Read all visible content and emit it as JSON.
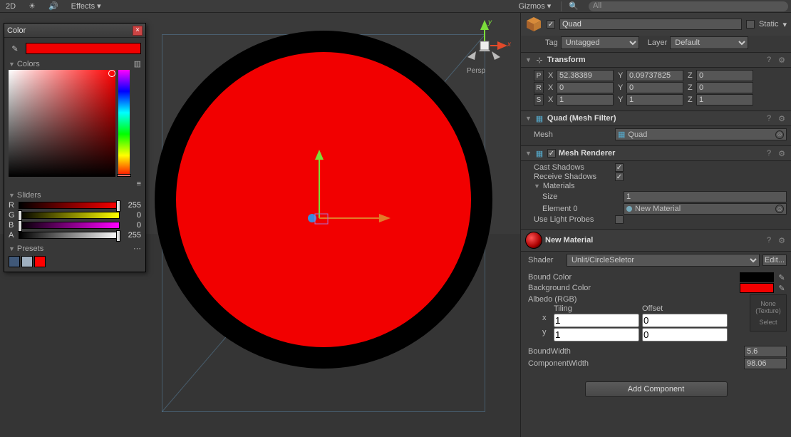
{
  "toolbar": {
    "btn_2d": "2D",
    "effects": "Effects",
    "gizmos": "Gizmos",
    "search_placeholder": "All"
  },
  "scene": {
    "persp_label": "Persp",
    "axis_x": "x",
    "axis_y": "y"
  },
  "color_picker": {
    "title": "Color",
    "colors_hdr": "Colors",
    "sliders_hdr": "Sliders",
    "presets_hdr": "Presets",
    "r_label": "R",
    "r_val": "255",
    "g_label": "G",
    "g_val": "0",
    "b_label": "B",
    "b_val": "0",
    "a_label": "A",
    "a_val": "255",
    "current_hex": "#FF0000",
    "presets": [
      "#405878",
      "#a0b0c0",
      "#ff0000"
    ]
  },
  "inspector": {
    "obj_name": "Quad",
    "static_label": "Static",
    "tag_label": "Tag",
    "tag_value": "Untagged",
    "layer_label": "Layer",
    "layer_value": "Default",
    "transform": {
      "name": "Transform",
      "p_label": "P",
      "r_label": "R",
      "s_label": "S",
      "px": "52.38389",
      "py": "0.09737825",
      "pz": "0",
      "rx": "0",
      "ry": "0",
      "rz": "0",
      "sx": "1",
      "sy": "1",
      "sz": "1",
      "X": "X",
      "Y": "Y",
      "Z": "Z"
    },
    "mesh_filter": {
      "name": "Quad (Mesh Filter)",
      "mesh_label": "Mesh",
      "mesh_value": "Quad"
    },
    "mesh_renderer": {
      "name": "Mesh Renderer",
      "cast_shadows": "Cast Shadows",
      "receive_shadows": "Receive Shadows",
      "materials": "Materials",
      "size_label": "Size",
      "size_value": "1",
      "element0_label": "Element 0",
      "element0_value": "New Material",
      "use_light_probes": "Use Light Probes"
    },
    "material": {
      "name": "New Material",
      "shader_label": "Shader",
      "shader_value": "Unlit/CircleSeletor",
      "edit_btn": "Edit...",
      "bound_color_label": "Bound Color",
      "bound_color": "#000000",
      "background_color_label": "Background Color",
      "background_color": "#ff0000",
      "albedo_label": "Albedo (RGB)",
      "tiling_label": "Tiling",
      "offset_label": "Offset",
      "x_label": "x",
      "y_label": "y",
      "tiling_x": "1",
      "tiling_y": "1",
      "offset_x": "0",
      "offset_y": "0",
      "tex_none": "None (Texture)",
      "tex_select": "Select",
      "bound_width_label": "BoundWidth",
      "bound_width_value": "5.6",
      "component_width_label": "ComponentWidth",
      "component_width_value": "98.06"
    },
    "add_component": "Add Component"
  }
}
